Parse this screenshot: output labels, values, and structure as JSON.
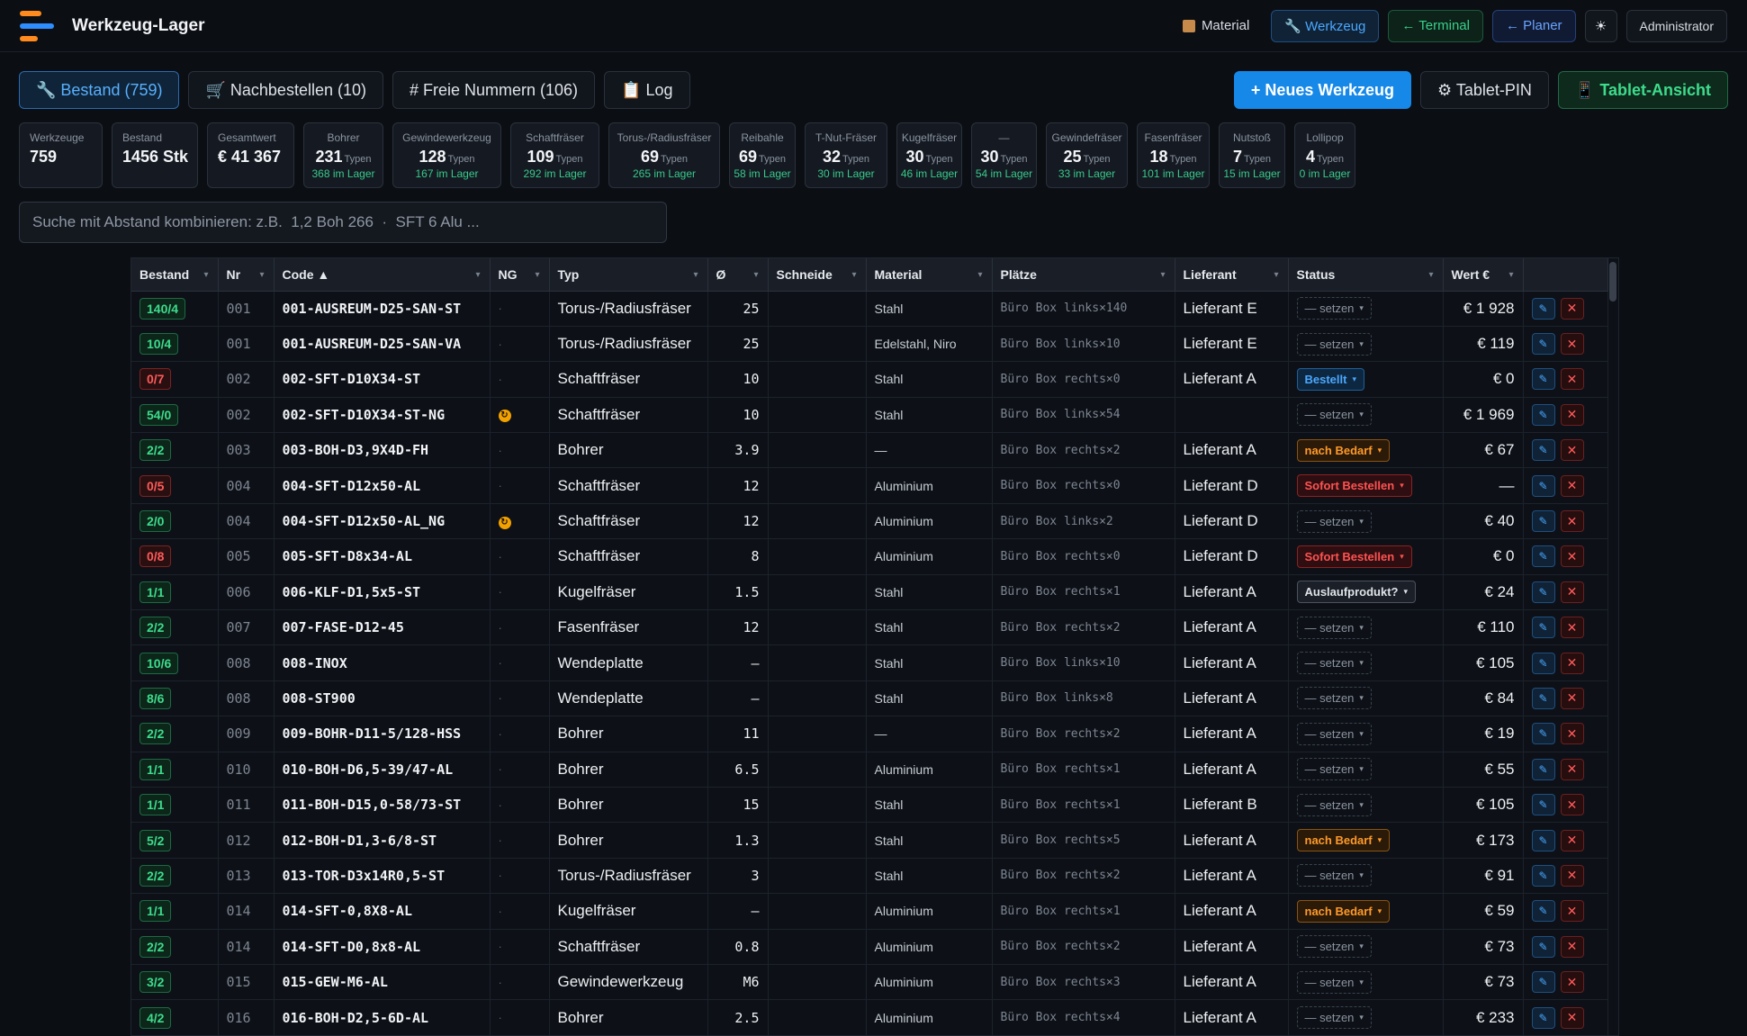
{
  "app": {
    "title": "Werkzeug-Lager"
  },
  "topnav": {
    "material": "Material",
    "werkzeug": "🔧 Werkzeug",
    "terminal": "← Terminal",
    "planer": "← Planer",
    "theme_icon": "☀",
    "user": "Administrator"
  },
  "tabs": [
    {
      "label": "🔧 Bestand (759)"
    },
    {
      "label": "🛒 Nachbestellen (10)"
    },
    {
      "label": "# Freie Nummern (106)"
    },
    {
      "label": "📋 Log"
    }
  ],
  "actions": {
    "new_tool": "+ Neues Werkzeug",
    "tablet_pin": "⚙ Tablet-PIN",
    "tablet_view": "📱 Tablet-Ansicht"
  },
  "stats": [
    {
      "label": "Werkzeuge",
      "value": "759"
    },
    {
      "label": "Bestand",
      "value": "1456 Stk"
    },
    {
      "label": "Gesamtwert",
      "value": "€ 41 367"
    },
    {
      "label": "Bohrer",
      "value": "231",
      "unit": "Typen",
      "sub": "368 im Lager"
    },
    {
      "label": "Gewindewerkzeug",
      "value": "128",
      "unit": "Typen",
      "sub": "167 im Lager"
    },
    {
      "label": "Schaftfräser",
      "value": "109",
      "unit": "Typen",
      "sub": "292 im Lager"
    },
    {
      "label": "Torus-/Radiusfräser",
      "value": "69",
      "unit": "Typen",
      "sub": "265 im Lager"
    },
    {
      "label": "Reibahle",
      "value": "69",
      "unit": "Typen",
      "sub": "58 im Lager"
    },
    {
      "label": "T-Nut-Fräser",
      "value": "32",
      "unit": "Typen",
      "sub": "30 im Lager"
    },
    {
      "label": "Kugelfräser",
      "value": "30",
      "unit": "Typen",
      "sub": "46 im Lager"
    },
    {
      "label": "—",
      "value": "30",
      "unit": "Typen",
      "sub": "54 im Lager"
    },
    {
      "label": "Gewindefräser",
      "value": "25",
      "unit": "Typen",
      "sub": "33 im Lager"
    },
    {
      "label": "Fasenfräser",
      "value": "18",
      "unit": "Typen",
      "sub": "101 im Lager"
    },
    {
      "label": "Nutstoß",
      "value": "7",
      "unit": "Typen",
      "sub": "15 im Lager"
    },
    {
      "label": "Lollipop",
      "value": "4",
      "unit": "Typen",
      "sub": "0 im Lager"
    }
  ],
  "search": {
    "placeholder": "Suche mit Abstand kombinieren: z.B.  1,2 Boh 266  ·  SFT 6 Alu ..."
  },
  "table": {
    "columns": [
      "Bestand",
      "Nr",
      "Code ▲",
      "NG",
      "Typ",
      "Ø",
      "Schneide",
      "Material",
      "Plätze",
      "Lieferant",
      "Status",
      "Wert €",
      ""
    ],
    "rows": [
      {
        "bestand": "140/4",
        "ok": true,
        "nr": "001",
        "code": "001-AUSREUM-D25-SAN-ST",
        "ng": false,
        "typ": "Torus-/Radiusfräser",
        "dia": "25",
        "mat": "Stahl",
        "plz": "Büro Box links×140",
        "lief": "Lieferant E",
        "status": "— setzen",
        "st": "setzen",
        "wert": "€ 1 928"
      },
      {
        "bestand": "10/4",
        "ok": true,
        "nr": "001",
        "code": "001-AUSREUM-D25-SAN-VA",
        "ng": false,
        "typ": "Torus-/Radiusfräser",
        "dia": "25",
        "mat": "Edelstahl, Niro",
        "plz": "Büro Box links×10",
        "lief": "Lieferant E",
        "status": "— setzen",
        "st": "setzen",
        "wert": "€ 119"
      },
      {
        "bestand": "0/7",
        "ok": false,
        "nr": "002",
        "code": "002-SFT-D10X34-ST",
        "ng": false,
        "typ": "Schaftfräser",
        "dia": "10",
        "mat": "Stahl",
        "plz": "Büro Box rechts×0",
        "lief": "Lieferant A",
        "status": "Bestellt",
        "st": "bestellt",
        "wert": "€ 0"
      },
      {
        "bestand": "54/0",
        "ok": true,
        "nr": "002",
        "code": "002-SFT-D10X34-ST-NG",
        "ng": true,
        "typ": "Schaftfräser",
        "dia": "10",
        "mat": "Stahl",
        "plz": "Büro Box links×54",
        "lief": "",
        "status": "— setzen",
        "st": "setzen",
        "wert": "€ 1 969"
      },
      {
        "bestand": "2/2",
        "ok": true,
        "nr": "003",
        "code": "003-BOH-D3,9X4D-FH",
        "ng": false,
        "typ": "Bohrer",
        "dia": "3.9",
        "mat": "—",
        "plz": "Büro Box rechts×2",
        "lief": "Lieferant A",
        "status": "nach Bedarf",
        "st": "bedarf",
        "wert": "€ 67"
      },
      {
        "bestand": "0/5",
        "ok": false,
        "nr": "004",
        "code": "004-SFT-D12x50-AL",
        "ng": false,
        "typ": "Schaftfräser",
        "dia": "12",
        "mat": "Aluminium",
        "plz": "Büro Box rechts×0",
        "lief": "Lieferant D",
        "status": "Sofort Bestellen",
        "st": "sofort",
        "wert": "—"
      },
      {
        "bestand": "2/0",
        "ok": true,
        "nr": "004",
        "code": "004-SFT-D12x50-AL_NG",
        "ng": true,
        "typ": "Schaftfräser",
        "dia": "12",
        "mat": "Aluminium",
        "plz": "Büro Box links×2",
        "lief": "Lieferant D",
        "status": "— setzen",
        "st": "setzen",
        "wert": "€ 40"
      },
      {
        "bestand": "0/8",
        "ok": false,
        "nr": "005",
        "code": "005-SFT-D8x34-AL",
        "ng": false,
        "typ": "Schaftfräser",
        "dia": "8",
        "mat": "Aluminium",
        "plz": "Büro Box rechts×0",
        "lief": "Lieferant D",
        "status": "Sofort Bestellen",
        "st": "sofort",
        "wert": "€ 0"
      },
      {
        "bestand": "1/1",
        "ok": true,
        "nr": "006",
        "code": "006-KLF-D1,5x5-ST",
        "ng": false,
        "typ": "Kugelfräser",
        "dia": "1.5",
        "mat": "Stahl",
        "plz": "Büro Box rechts×1",
        "lief": "Lieferant A",
        "status": "Auslaufprodukt?",
        "st": "auslauf",
        "wert": "€ 24"
      },
      {
        "bestand": "2/2",
        "ok": true,
        "nr": "007",
        "code": "007-FASE-D12-45",
        "ng": false,
        "typ": "Fasenfräser",
        "dia": "12",
        "mat": "Stahl",
        "plz": "Büro Box rechts×2",
        "lief": "Lieferant A",
        "status": "— setzen",
        "st": "setzen",
        "wert": "€ 110"
      },
      {
        "bestand": "10/6",
        "ok": true,
        "nr": "008",
        "code": "008-INOX",
        "ng": false,
        "typ": "Wendeplatte",
        "dia": "–",
        "mat": "Stahl",
        "plz": "Büro Box links×10",
        "lief": "Lieferant A",
        "status": "— setzen",
        "st": "setzen",
        "wert": "€ 105"
      },
      {
        "bestand": "8/6",
        "ok": true,
        "nr": "008",
        "code": "008-ST900",
        "ng": false,
        "typ": "Wendeplatte",
        "dia": "–",
        "mat": "Stahl",
        "plz": "Büro Box links×8",
        "lief": "Lieferant A",
        "status": "— setzen",
        "st": "setzen",
        "wert": "€ 84"
      },
      {
        "bestand": "2/2",
        "ok": true,
        "nr": "009",
        "code": "009-BOHR-D11-5/128-HSS",
        "ng": false,
        "typ": "Bohrer",
        "dia": "11",
        "mat": "—",
        "plz": "Büro Box rechts×2",
        "lief": "Lieferant A",
        "status": "— setzen",
        "st": "setzen",
        "wert": "€ 19"
      },
      {
        "bestand": "1/1",
        "ok": true,
        "nr": "010",
        "code": "010-BOH-D6,5-39/47-AL",
        "ng": false,
        "typ": "Bohrer",
        "dia": "6.5",
        "mat": "Aluminium",
        "plz": "Büro Box rechts×1",
        "lief": "Lieferant A",
        "status": "— setzen",
        "st": "setzen",
        "wert": "€ 55"
      },
      {
        "bestand": "1/1",
        "ok": true,
        "nr": "011",
        "code": "011-BOH-D15,0-58/73-ST",
        "ng": false,
        "typ": "Bohrer",
        "dia": "15",
        "mat": "Stahl",
        "plz": "Büro Box rechts×1",
        "lief": "Lieferant B",
        "status": "— setzen",
        "st": "setzen",
        "wert": "€ 105"
      },
      {
        "bestand": "5/2",
        "ok": true,
        "nr": "012",
        "code": "012-BOH-D1,3-6/8-ST",
        "ng": false,
        "typ": "Bohrer",
        "dia": "1.3",
        "mat": "Stahl",
        "plz": "Büro Box rechts×5",
        "lief": "Lieferant A",
        "status": "nach Bedarf",
        "st": "bedarf",
        "wert": "€ 173"
      },
      {
        "bestand": "2/2",
        "ok": true,
        "nr": "013",
        "code": "013-TOR-D3x14R0,5-ST",
        "ng": false,
        "typ": "Torus-/Radiusfräser",
        "dia": "3",
        "mat": "Stahl",
        "plz": "Büro Box rechts×2",
        "lief": "Lieferant A",
        "status": "— setzen",
        "st": "setzen",
        "wert": "€ 91"
      },
      {
        "bestand": "1/1",
        "ok": true,
        "nr": "014",
        "code": "014-SFT-0,8X8-AL",
        "ng": false,
        "typ": "Kugelfräser",
        "dia": "–",
        "mat": "Aluminium",
        "plz": "Büro Box rechts×1",
        "lief": "Lieferant A",
        "status": "nach Bedarf",
        "st": "bedarf",
        "wert": "€ 59"
      },
      {
        "bestand": "2/2",
        "ok": true,
        "nr": "014",
        "code": "014-SFT-D0,8x8-AL",
        "ng": false,
        "typ": "Schaftfräser",
        "dia": "0.8",
        "mat": "Aluminium",
        "plz": "Büro Box rechts×2",
        "lief": "Lieferant A",
        "status": "— setzen",
        "st": "setzen",
        "wert": "€ 73"
      },
      {
        "bestand": "3/2",
        "ok": true,
        "nr": "015",
        "code": "015-GEW-M6-AL",
        "ng": false,
        "typ": "Gewindewerkzeug",
        "dia": "M6",
        "mat": "Aluminium",
        "plz": "Büro Box rechts×3",
        "lief": "Lieferant A",
        "status": "— setzen",
        "st": "setzen",
        "wert": "€ 73"
      },
      {
        "bestand": "4/2",
        "ok": true,
        "nr": "016",
        "code": "016-BOH-D2,5-6D-AL",
        "ng": false,
        "typ": "Bohrer",
        "dia": "2.5",
        "mat": "Aluminium",
        "plz": "Büro Box rechts×4",
        "lief": "Lieferant A",
        "status": "— setzen",
        "st": "setzen",
        "wert": "€ 233"
      }
    ]
  }
}
